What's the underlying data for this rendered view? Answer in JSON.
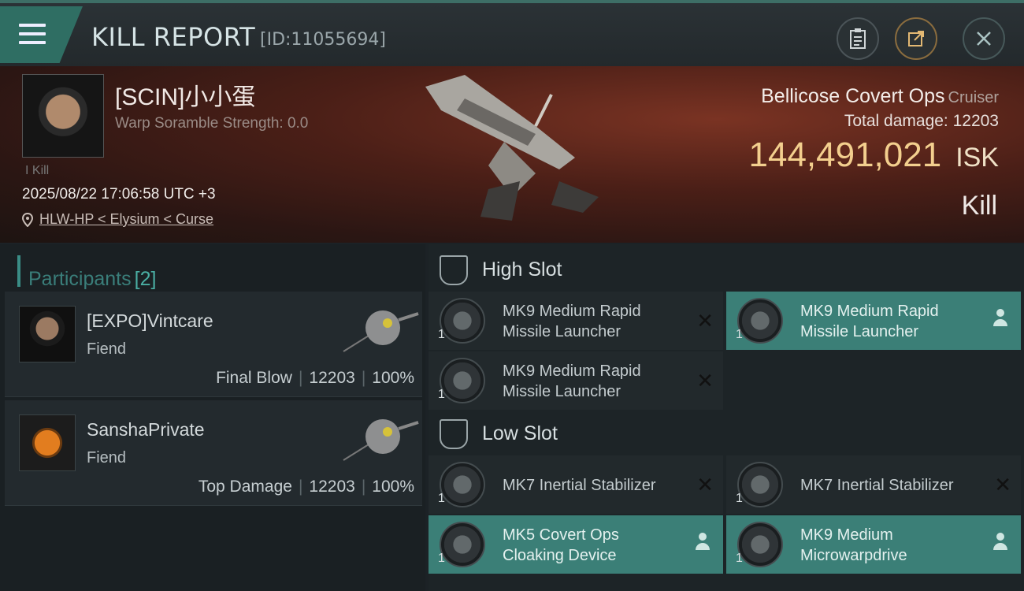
{
  "header": {
    "title": "KILL REPORT",
    "report_id": "[ID:11055694]"
  },
  "victim": {
    "name": "[SCIN]小小蛋",
    "scramble": "Warp Soramble Strength: 0.0",
    "kill_tag": "I Kill",
    "date": "2025/08/22 17:06:58 UTC +3",
    "location": "HLW-HP < Elysium < Curse",
    "ship": "Bellicose Covert Ops",
    "ship_class": "Cruiser",
    "total_damage": "Total damage:  12203",
    "isk_value": "144,491,021",
    "isk_unit": "ISK",
    "result": "Kill"
  },
  "participants": {
    "label": "Participants",
    "count": "[2]",
    "rows": [
      {
        "name": "[EXPO]Vintcare",
        "corp": "Fiend",
        "role": "Final Blow",
        "damage": "12203",
        "percent": "100%"
      },
      {
        "name": "SanshaPrivate",
        "corp": "Fiend",
        "role": "Top Damage",
        "damage": "12203",
        "percent": "100%"
      }
    ]
  },
  "slots": {
    "high": {
      "label": "High Slot",
      "items": [
        {
          "line1": "MK9 Medium Rapid",
          "line2": "Missile Launcher",
          "qty": "1",
          "status": "destroyed"
        },
        {
          "line1": "MK9 Medium Rapid",
          "line2": "Missile Launcher",
          "qty": "1",
          "status": "dropped"
        },
        {
          "line1": "MK9 Medium Rapid",
          "line2": "Missile Launcher",
          "qty": "1",
          "status": "destroyed"
        }
      ]
    },
    "low": {
      "label": "Low Slot",
      "items": [
        {
          "line1": "MK7 Inertial Stabilizer",
          "line2": "",
          "qty": "1",
          "status": "destroyed"
        },
        {
          "line1": "MK7 Inertial Stabilizer",
          "line2": "",
          "qty": "1",
          "status": "destroyed"
        },
        {
          "line1": "MK5 Covert Ops",
          "line2": "Cloaking Device",
          "qty": "1",
          "status": "dropped"
        },
        {
          "line1": "MK9 Medium",
          "line2": "Microwarpdrive",
          "qty": "1",
          "status": "dropped"
        }
      ]
    }
  },
  "icons": {
    "x": "✕"
  }
}
